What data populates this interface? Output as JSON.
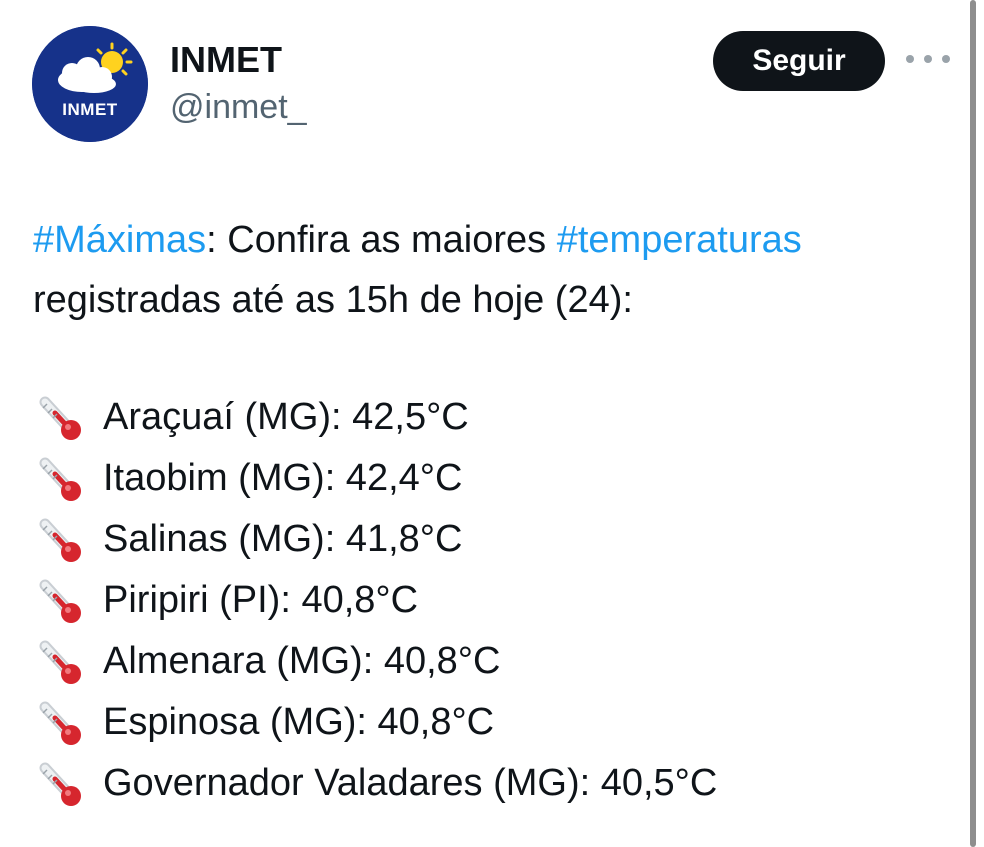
{
  "account": {
    "display_name": "INMET",
    "handle": "@inmet_",
    "avatar_text": "INMET"
  },
  "actions": {
    "follow_label": "Seguir",
    "more_icon": "more-horizontal-icon"
  },
  "tweet": {
    "hashtag_1": "#Máximas",
    "text_1": ": Confira as maiores ",
    "hashtag_2": "#temperaturas",
    "line_2": "registradas até as 15h de hoje (24):",
    "list_icon": "thermometer-icon",
    "items": [
      {
        "text": "Araçuaí (MG): 42,5°C"
      },
      {
        "text": "Itaobim (MG): 42,4°C"
      },
      {
        "text": "Salinas (MG): 41,8°C"
      },
      {
        "text": "Piripiri (PI): 40,8°C"
      },
      {
        "text": "Almenara (MG): 40,8°C"
      },
      {
        "text": "Espinosa (MG): 40,8°C"
      },
      {
        "text": "Governador Valadares (MG): 40,5°C"
      }
    ]
  },
  "colors": {
    "hashtag": "#1d9bf0",
    "follow_button_bg": "#0f1419",
    "handle": "#536471",
    "avatar_bg": "#16328a"
  }
}
